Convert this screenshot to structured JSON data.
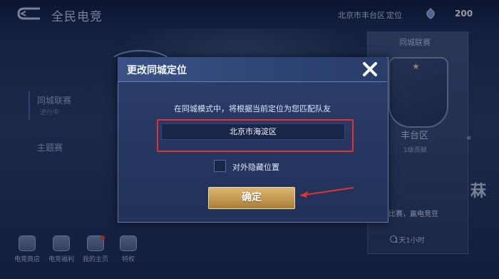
{
  "header": {
    "app_title": "全民电竞",
    "location_text": "北京市丰台区",
    "locate_label": "定位",
    "coin_count": "200"
  },
  "sidebar": {
    "items": [
      {
        "label": "同城联赛",
        "sub": "进行中"
      },
      {
        "label": "主题赛"
      }
    ]
  },
  "right_panel": {
    "title": "同城联赛",
    "district": "丰台区",
    "rank": "1级贡献",
    "promo": "与比赛，赢电竞豆",
    "timer": "1天1小时",
    "edge_char": "菻"
  },
  "bottom_nav": [
    {
      "label": "电竞商店",
      "icon": "shop-icon"
    },
    {
      "label": "电竞福利",
      "icon": "gift-icon"
    },
    {
      "label": "我的主页",
      "icon": "profile-icon"
    },
    {
      "label": "特权",
      "icon": "crown-icon"
    }
  ],
  "modal": {
    "title": "更改同城定位",
    "message": "在同城模式中，将根据当前定位为您匹配队友",
    "city_value": "北京市海淀区",
    "hide_location_label": "对外隐藏位置",
    "hide_location_checked": false,
    "confirm_label": "确定"
  },
  "colors": {
    "annotation_red": "#e0322e",
    "button_gold": "#c49850"
  }
}
